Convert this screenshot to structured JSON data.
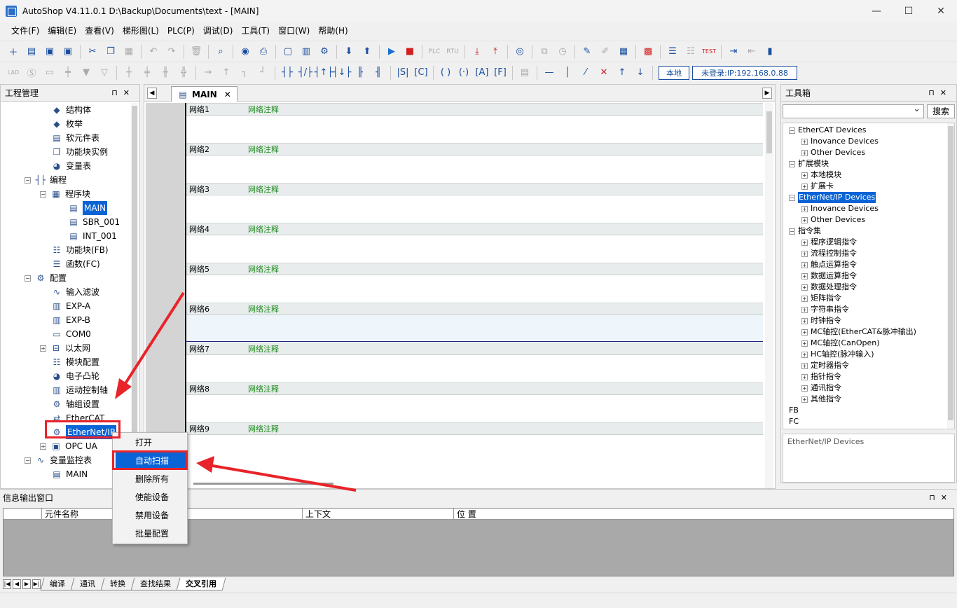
{
  "window": {
    "title": "AutoShop V4.11.0.1  D:\\Backup\\Documents\\text - [MAIN]",
    "minimize": "—",
    "maximize": "☐",
    "close": "✕"
  },
  "menu": [
    "文件(F)",
    "编辑(E)",
    "查看(V)",
    "梯形图(L)",
    "PLC(P)",
    "调试(D)",
    "工具(T)",
    "窗口(W)",
    "帮助(H)"
  ],
  "toolbar2": {
    "local_label": "本地",
    "status_label": "未登录:IP:192.168.0.88"
  },
  "project_panel": {
    "title": "工程管理",
    "pin": "⊓",
    "close": "✕",
    "items": [
      {
        "label": "结构体",
        "icon": "struct-icon"
      },
      {
        "label": "枚举",
        "icon": "enum-icon"
      },
      {
        "label": "软元件表",
        "icon": "device-table-icon"
      },
      {
        "label": "功能块实例",
        "icon": "fb-instance-icon"
      },
      {
        "label": "变量表",
        "icon": "variable-table-icon"
      },
      {
        "label": "编程",
        "icon": "programming-icon"
      },
      {
        "label": "程序块",
        "icon": "program-block-icon"
      },
      {
        "label": "MAIN",
        "icon": "main-program-icon"
      },
      {
        "label": "SBR_001",
        "icon": "subroutine-icon"
      },
      {
        "label": "INT_001",
        "icon": "interrupt-icon"
      },
      {
        "label": "功能块(FB)",
        "icon": "function-block-icon"
      },
      {
        "label": "函数(FC)",
        "icon": "function-icon"
      },
      {
        "label": "配置",
        "icon": "config-icon"
      },
      {
        "label": "输入滤波",
        "icon": "input-filter-icon"
      },
      {
        "label": "EXP-A",
        "icon": "expansion-icon"
      },
      {
        "label": "EXP-B",
        "icon": "expansion-icon"
      },
      {
        "label": "COM0",
        "icon": "serial-port-icon"
      },
      {
        "label": "以太网",
        "icon": "ethernet-icon"
      },
      {
        "label": "模块配置",
        "icon": "module-config-icon"
      },
      {
        "label": "电子凸轮",
        "icon": "cam-icon"
      },
      {
        "label": "运动控制轴",
        "icon": "motion-axis-icon"
      },
      {
        "label": "轴组设置",
        "icon": "axis-group-icon"
      },
      {
        "label": "EtherCAT",
        "icon": "ethercat-icon"
      },
      {
        "label": "EtherNet/IP",
        "icon": "ethernetip-icon"
      },
      {
        "label": "OPC UA",
        "icon": "opcua-icon"
      },
      {
        "label": "变量监控表",
        "icon": "monitor-table-icon"
      },
      {
        "label": "MAIN",
        "icon": "monitor-main-icon"
      }
    ]
  },
  "document": {
    "tab_label": "MAIN",
    "tab_close": "✕",
    "networks": [
      {
        "label": "网络1",
        "comment": "网络注释"
      },
      {
        "label": "网络2",
        "comment": "网络注释"
      },
      {
        "label": "网络3",
        "comment": "网络注释"
      },
      {
        "label": "网络4",
        "comment": "网络注释"
      },
      {
        "label": "网络5",
        "comment": "网络注释"
      },
      {
        "label": "网络6",
        "comment": "网络注释"
      },
      {
        "label": "网络7",
        "comment": "网络注释"
      },
      {
        "label": "网络8",
        "comment": "网络注释"
      },
      {
        "label": "网络9",
        "comment": "网络注释"
      }
    ]
  },
  "toolbox": {
    "title": "工具箱",
    "search_button": "搜索",
    "description": "EtherNet/IP Devices",
    "items": [
      {
        "label": "EtherCAT Devices",
        "level": 0
      },
      {
        "label": "Inovance Devices",
        "level": 1
      },
      {
        "label": "Other Devices",
        "level": 1
      },
      {
        "label": "扩展模块",
        "level": 0
      },
      {
        "label": "本地模块",
        "level": 1
      },
      {
        "label": "扩展卡",
        "level": 1
      },
      {
        "label": "EtherNet/IP Devices",
        "level": 0
      },
      {
        "label": "Inovance Devices",
        "level": 1
      },
      {
        "label": "Other Devices",
        "level": 1
      },
      {
        "label": "指令集",
        "level": 0
      },
      {
        "label": "程序逻辑指令",
        "level": 1
      },
      {
        "label": "流程控制指令",
        "level": 1
      },
      {
        "label": "触点运算指令",
        "level": 1
      },
      {
        "label": "数据运算指令",
        "level": 1
      },
      {
        "label": "数据处理指令",
        "level": 1
      },
      {
        "label": "矩阵指令",
        "level": 1
      },
      {
        "label": "字符串指令",
        "level": 1
      },
      {
        "label": "时钟指令",
        "level": 1
      },
      {
        "label": "MC轴控(EtherCAT&脉冲输出)",
        "level": 1
      },
      {
        "label": "MC轴控(CanOpen)",
        "level": 1
      },
      {
        "label": "HC轴控(脉冲输入)",
        "level": 1
      },
      {
        "label": "定时器指令",
        "level": 1
      },
      {
        "label": "指针指令",
        "level": 1
      },
      {
        "label": "通讯指令",
        "level": 1
      },
      {
        "label": "其他指令",
        "level": 1
      },
      {
        "label": "FB",
        "level": 0
      },
      {
        "label": "FC",
        "level": 0
      }
    ]
  },
  "info_window": {
    "title": "信息输出窗口",
    "columns": [
      "元件名称",
      "上下文",
      "位 置"
    ],
    "tabs": [
      "编译",
      "通讯",
      "转换",
      "查找结果",
      "交叉引用"
    ]
  },
  "context_menu": {
    "items": [
      "打开",
      "自动扫描",
      "删除所有",
      "使能设备",
      "禁用设备",
      "批量配置"
    ],
    "highlighted": "自动扫描"
  },
  "colors": {
    "selection": "#0a64d6",
    "annotation_red": "#e8232a",
    "comment_green": "#1a8a1a"
  }
}
